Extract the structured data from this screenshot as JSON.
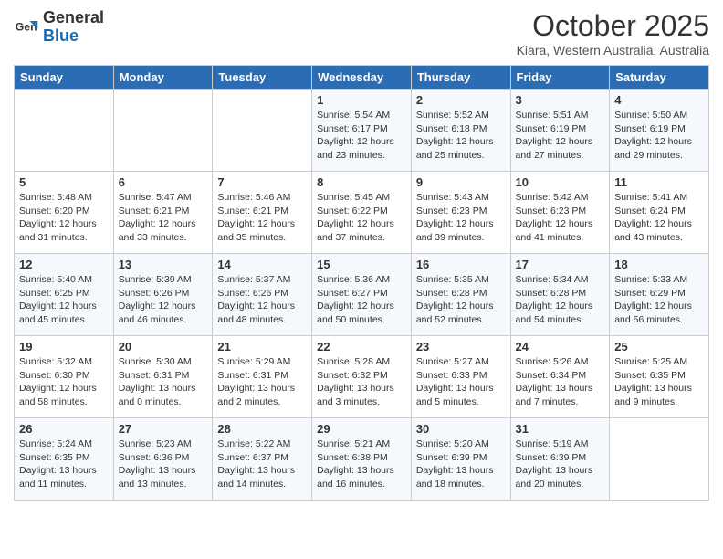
{
  "header": {
    "logo_general": "General",
    "logo_blue": "Blue",
    "month_year": "October 2025",
    "location": "Kiara, Western Australia, Australia"
  },
  "days_of_week": [
    "Sunday",
    "Monday",
    "Tuesday",
    "Wednesday",
    "Thursday",
    "Friday",
    "Saturday"
  ],
  "weeks": [
    [
      {
        "day": "",
        "info": ""
      },
      {
        "day": "",
        "info": ""
      },
      {
        "day": "",
        "info": ""
      },
      {
        "day": "1",
        "info": "Sunrise: 5:54 AM\nSunset: 6:17 PM\nDaylight: 12 hours\nand 23 minutes."
      },
      {
        "day": "2",
        "info": "Sunrise: 5:52 AM\nSunset: 6:18 PM\nDaylight: 12 hours\nand 25 minutes."
      },
      {
        "day": "3",
        "info": "Sunrise: 5:51 AM\nSunset: 6:19 PM\nDaylight: 12 hours\nand 27 minutes."
      },
      {
        "day": "4",
        "info": "Sunrise: 5:50 AM\nSunset: 6:19 PM\nDaylight: 12 hours\nand 29 minutes."
      }
    ],
    [
      {
        "day": "5",
        "info": "Sunrise: 5:48 AM\nSunset: 6:20 PM\nDaylight: 12 hours\nand 31 minutes."
      },
      {
        "day": "6",
        "info": "Sunrise: 5:47 AM\nSunset: 6:21 PM\nDaylight: 12 hours\nand 33 minutes."
      },
      {
        "day": "7",
        "info": "Sunrise: 5:46 AM\nSunset: 6:21 PM\nDaylight: 12 hours\nand 35 minutes."
      },
      {
        "day": "8",
        "info": "Sunrise: 5:45 AM\nSunset: 6:22 PM\nDaylight: 12 hours\nand 37 minutes."
      },
      {
        "day": "9",
        "info": "Sunrise: 5:43 AM\nSunset: 6:23 PM\nDaylight: 12 hours\nand 39 minutes."
      },
      {
        "day": "10",
        "info": "Sunrise: 5:42 AM\nSunset: 6:23 PM\nDaylight: 12 hours\nand 41 minutes."
      },
      {
        "day": "11",
        "info": "Sunrise: 5:41 AM\nSunset: 6:24 PM\nDaylight: 12 hours\nand 43 minutes."
      }
    ],
    [
      {
        "day": "12",
        "info": "Sunrise: 5:40 AM\nSunset: 6:25 PM\nDaylight: 12 hours\nand 45 minutes."
      },
      {
        "day": "13",
        "info": "Sunrise: 5:39 AM\nSunset: 6:26 PM\nDaylight: 12 hours\nand 46 minutes."
      },
      {
        "day": "14",
        "info": "Sunrise: 5:37 AM\nSunset: 6:26 PM\nDaylight: 12 hours\nand 48 minutes."
      },
      {
        "day": "15",
        "info": "Sunrise: 5:36 AM\nSunset: 6:27 PM\nDaylight: 12 hours\nand 50 minutes."
      },
      {
        "day": "16",
        "info": "Sunrise: 5:35 AM\nSunset: 6:28 PM\nDaylight: 12 hours\nand 52 minutes."
      },
      {
        "day": "17",
        "info": "Sunrise: 5:34 AM\nSunset: 6:28 PM\nDaylight: 12 hours\nand 54 minutes."
      },
      {
        "day": "18",
        "info": "Sunrise: 5:33 AM\nSunset: 6:29 PM\nDaylight: 12 hours\nand 56 minutes."
      }
    ],
    [
      {
        "day": "19",
        "info": "Sunrise: 5:32 AM\nSunset: 6:30 PM\nDaylight: 12 hours\nand 58 minutes."
      },
      {
        "day": "20",
        "info": "Sunrise: 5:30 AM\nSunset: 6:31 PM\nDaylight: 13 hours\nand 0 minutes."
      },
      {
        "day": "21",
        "info": "Sunrise: 5:29 AM\nSunset: 6:31 PM\nDaylight: 13 hours\nand 2 minutes."
      },
      {
        "day": "22",
        "info": "Sunrise: 5:28 AM\nSunset: 6:32 PM\nDaylight: 13 hours\nand 3 minutes."
      },
      {
        "day": "23",
        "info": "Sunrise: 5:27 AM\nSunset: 6:33 PM\nDaylight: 13 hours\nand 5 minutes."
      },
      {
        "day": "24",
        "info": "Sunrise: 5:26 AM\nSunset: 6:34 PM\nDaylight: 13 hours\nand 7 minutes."
      },
      {
        "day": "25",
        "info": "Sunrise: 5:25 AM\nSunset: 6:35 PM\nDaylight: 13 hours\nand 9 minutes."
      }
    ],
    [
      {
        "day": "26",
        "info": "Sunrise: 5:24 AM\nSunset: 6:35 PM\nDaylight: 13 hours\nand 11 minutes."
      },
      {
        "day": "27",
        "info": "Sunrise: 5:23 AM\nSunset: 6:36 PM\nDaylight: 13 hours\nand 13 minutes."
      },
      {
        "day": "28",
        "info": "Sunrise: 5:22 AM\nSunset: 6:37 PM\nDaylight: 13 hours\nand 14 minutes."
      },
      {
        "day": "29",
        "info": "Sunrise: 5:21 AM\nSunset: 6:38 PM\nDaylight: 13 hours\nand 16 minutes."
      },
      {
        "day": "30",
        "info": "Sunrise: 5:20 AM\nSunset: 6:39 PM\nDaylight: 13 hours\nand 18 minutes."
      },
      {
        "day": "31",
        "info": "Sunrise: 5:19 AM\nSunset: 6:39 PM\nDaylight: 13 hours\nand 20 minutes."
      },
      {
        "day": "",
        "info": ""
      }
    ]
  ]
}
